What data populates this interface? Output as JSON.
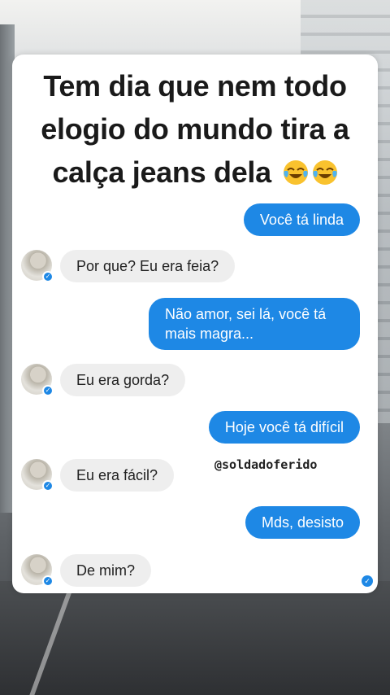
{
  "headline": {
    "text": "Tem dia que nem todo elogio do mundo tira a calça jeans dela",
    "emoji": [
      "face-with-tears-of-joy-icon",
      "face-with-tears-of-joy-icon"
    ]
  },
  "watermark": "@soldadoferido",
  "messages": [
    {
      "side": "out",
      "text": "Você tá linda"
    },
    {
      "side": "in",
      "text": "Por que? Eu era feia?"
    },
    {
      "side": "out",
      "text": "Não amor, sei lá, você tá mais magra..."
    },
    {
      "side": "in",
      "text": "Eu era gorda?"
    },
    {
      "side": "out",
      "text": "Hoje você tá difícil"
    },
    {
      "side": "in",
      "text": "Eu era fácil?"
    },
    {
      "side": "out",
      "text": "Mds, desisto"
    },
    {
      "side": "in",
      "text": "De mim?"
    }
  ],
  "colors": {
    "outgoing_bubble": "#1e88e5",
    "incoming_bubble": "#eeeeee",
    "card": "#ffffff"
  },
  "status": {
    "seen_icon": "seen-check-icon"
  }
}
